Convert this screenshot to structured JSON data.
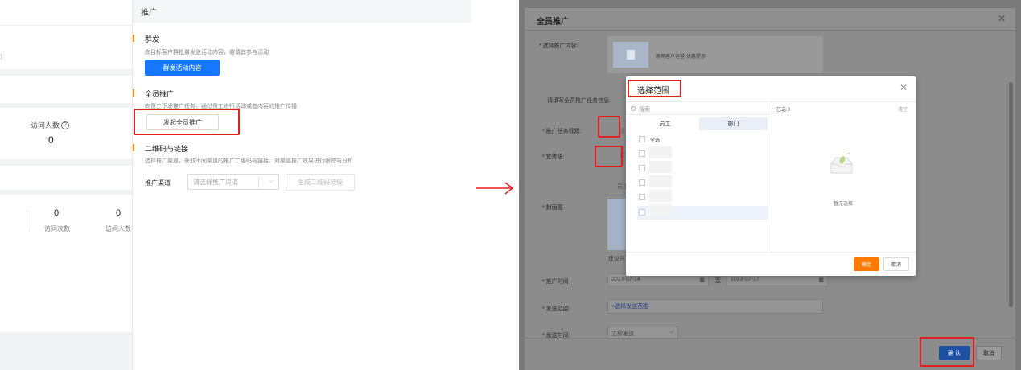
{
  "left": {
    "stats_top": {
      "hint_paren": "）",
      "visitors_label": "访问人数",
      "visitors_value": "0"
    },
    "stats_bottom": {
      "visits_value": "0",
      "visits_label": "访问次数",
      "visitors_value": "0",
      "visitors_label": "访问人数"
    },
    "panel": {
      "header": "推广",
      "mass": {
        "title": "群发",
        "desc": "向目标客户群批量发送活动内容，邀请其参与活动",
        "button": "群发活动内容"
      },
      "all_staff": {
        "title": "全员推广",
        "desc": "向员工下发推广任务，通过员工进行活动或者内容的推广传播",
        "button": "发起全员推广"
      },
      "qr": {
        "title": "二维码与链接",
        "desc": "选择推广渠道，获取不同渠道的推广二维码与链接，对渠道推广效果进行跟踪与分析",
        "channel_label": "推广渠道",
        "channel_placeholder": "请选择推广渠道",
        "generate_button": "生成二维码链接"
      }
    },
    "colors": {
      "accent_orange": "#ff8a00",
      "primary_blue": "#1677ff",
      "highlight_red": "#e02020"
    }
  },
  "right": {
    "dialog": {
      "title": "全员推广",
      "labels": {
        "content": "* 选择推广内容:",
        "task_info": "请填写全员推广任务信息:",
        "task_title": "* 推广任务标题:",
        "slogan": "* 宣传语:",
        "cover": "* 封面图",
        "time": "* 推广时间",
        "range": "* 发送范围:",
        "send_time": "* 发送时间:"
      },
      "content_name": "新用客户运营-优惠提示",
      "start_date": "2023-07-14",
      "to_text": "至",
      "end_date": "2023-07-17",
      "range_link": "+选择发送范围",
      "send_time_value": "立即发送",
      "task_title_fragment": "请",
      "slogan_fragment": "请",
      "staff_fragment": "员工",
      "cover_hint": "建议尺寸",
      "ok_button": "确 认",
      "cancel_button": "取消"
    },
    "scope": {
      "title": "选择范围",
      "search_placeholder": "搜索",
      "tab_staff": "员工",
      "tab_dept": "部门",
      "select_all": "全选",
      "selected_count": "已选 0",
      "clear": "清空",
      "empty_text": "暂无选择",
      "confirm_button": "确定",
      "cancel_button": "取消"
    }
  }
}
